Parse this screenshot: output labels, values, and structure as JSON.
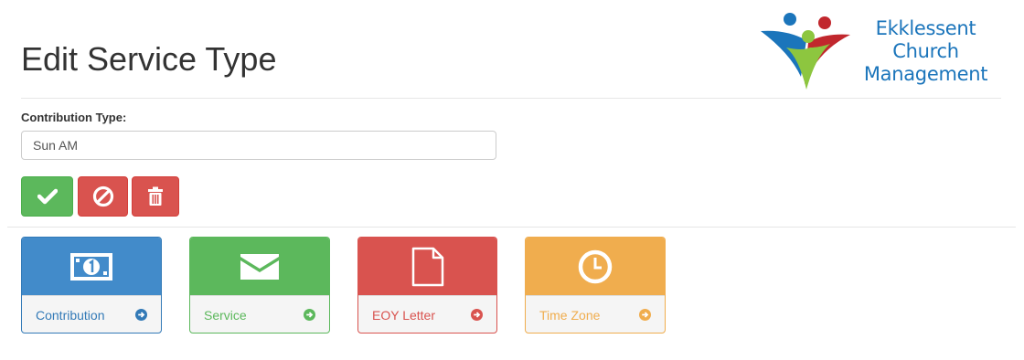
{
  "page": {
    "title": "Edit Service Type"
  },
  "logo": {
    "line1": "Ekklessent",
    "line2": "Church",
    "line3": "Management",
    "brand_color": "#1b75bb"
  },
  "form": {
    "label": "Contribution Type:",
    "value": "Sun AM"
  },
  "actions": {
    "save_icon": "check-icon",
    "cancel_icon": "ban-icon",
    "delete_icon": "trash-icon",
    "save_color": "#5cb85c",
    "danger_color": "#d9534f"
  },
  "tiles": [
    {
      "label": "Contribution",
      "icon": "money-icon",
      "color": "#428bca"
    },
    {
      "label": "Service",
      "icon": "envelope-icon",
      "color": "#5cb85c"
    },
    {
      "label": "EOY Letter",
      "icon": "file-icon",
      "color": "#d9534f"
    },
    {
      "label": "Time Zone",
      "icon": "clock-icon",
      "color": "#f0ad4e"
    }
  ]
}
